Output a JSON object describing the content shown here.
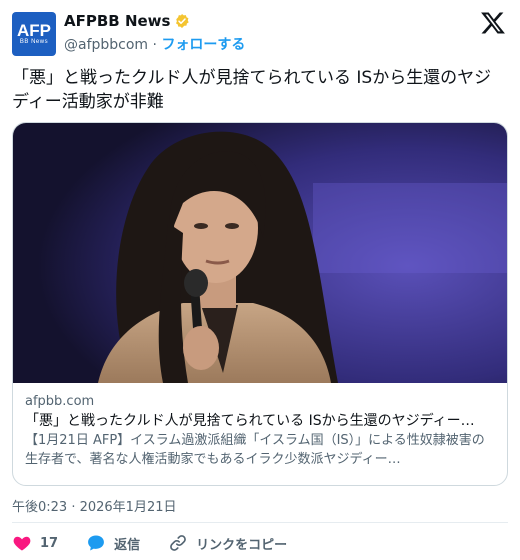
{
  "account": {
    "avatar_text": "AFP",
    "avatar_subtext": "BB News",
    "name": "AFPBB News",
    "handle": "@afpbbcom",
    "separator": "·",
    "follow_label": "フォローする"
  },
  "tweet": {
    "text": "「悪」と戦ったクルド人が見捨てられている ISから生還のヤジディー活動家が非難"
  },
  "link_card": {
    "domain": "afpbb.com",
    "title": "「悪」と戦ったクルド人が見捨てられている ISから生還のヤジディー…",
    "description": "【1月21日 AFP】イスラム過激派組織「イスラム国（IS）」による性奴隷被害の生存者で、著名な人権活動家でもあるイラク少数派ヤジディー…"
  },
  "timestamp": "午後0:23 · 2026年1月21日",
  "actions": {
    "like_count": "17",
    "reply_label": "返信",
    "copy_link_label": "リンクをコピー"
  },
  "colors": {
    "accent": "#1d9bf0",
    "avatar_bg": "#1d5fc1",
    "like": "#f91880",
    "verified": "#f4c430"
  },
  "icons": {
    "verified": "verified-badge-icon",
    "platform": "x-logo-icon",
    "like": "heart-icon",
    "reply": "reply-bubble-icon",
    "copy": "link-icon"
  }
}
